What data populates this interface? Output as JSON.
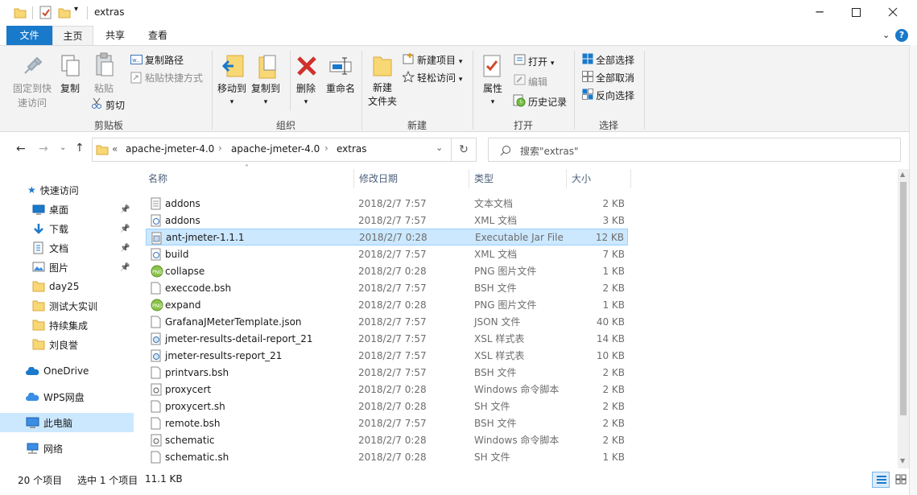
{
  "window": {
    "title": "extras"
  },
  "tabs": {
    "file": "文件",
    "home": "主页",
    "share": "共享",
    "view": "查看"
  },
  "ribbon": {
    "pin": "固定到快",
    "pin2": "速访问",
    "copy": "复制",
    "paste": "粘贴",
    "copy_path": "复制路径",
    "paste_shortcut": "粘贴快捷方式",
    "cut": "剪切",
    "clipboard": "剪贴板",
    "move_to": "移动到",
    "copy_to": "复制到",
    "delete": "删除",
    "rename": "重命名",
    "organize": "组织",
    "new_folder": "新建",
    "new_folder2": "文件夹",
    "new_item": "新建项目",
    "easy_access": "轻松访问",
    "new_group": "新建",
    "properties": "属性",
    "open": "打开",
    "edit": "编辑",
    "history": "历史记录",
    "open_group": "打开",
    "select_all": "全部选择",
    "select_none": "全部取消",
    "invert": "反向选择",
    "select_group": "选择"
  },
  "address": {
    "prefix": "«",
    "crumbs": [
      "apache-jmeter-4.0",
      "apache-jmeter-4.0",
      "extras"
    ],
    "search_placeholder": "搜索\"extras\""
  },
  "nav": {
    "quick_access": "快速访问",
    "items": [
      {
        "label": "桌面",
        "icon": "desktop-icon",
        "pinned": true
      },
      {
        "label": "下载",
        "icon": "download-icon",
        "pinned": true
      },
      {
        "label": "文档",
        "icon": "document-icon",
        "pinned": true
      },
      {
        "label": "图片",
        "icon": "picture-icon",
        "pinned": true
      },
      {
        "label": "day25",
        "icon": "folder-icon"
      },
      {
        "label": "测试大实训",
        "icon": "folder-icon"
      },
      {
        "label": "持续集成",
        "icon": "folder-icon"
      },
      {
        "label": "刘良誉",
        "icon": "folder-icon"
      }
    ],
    "onedrive": "OneDrive",
    "wps": "WPS网盘",
    "this_pc": "此电脑",
    "network": "网络"
  },
  "columns": {
    "name": "名称",
    "date": "修改日期",
    "type": "类型",
    "size": "大小"
  },
  "files": [
    {
      "name": "addons",
      "date": "2018/2/7 7:57",
      "type": "文本文档",
      "size": "2 KB",
      "icon": "text-file-icon"
    },
    {
      "name": "addons",
      "date": "2018/2/7 7:57",
      "type": "XML 文档",
      "size": "3 KB",
      "icon": "xml-file-icon"
    },
    {
      "name": "ant-jmeter-1.1.1",
      "date": "2018/2/7 0:28",
      "type": "Executable Jar File",
      "size": "12 KB",
      "icon": "jar-file-icon",
      "selected": true
    },
    {
      "name": "build",
      "date": "2018/2/7 7:57",
      "type": "XML 文档",
      "size": "7 KB",
      "icon": "xml-file-icon"
    },
    {
      "name": "collapse",
      "date": "2018/2/7 0:28",
      "type": "PNG 图片文件",
      "size": "1 KB",
      "icon": "png-file-icon"
    },
    {
      "name": "execcode.bsh",
      "date": "2018/2/7 7:57",
      "type": "BSH 文件",
      "size": "2 KB",
      "icon": "blank-file-icon"
    },
    {
      "name": "expand",
      "date": "2018/2/7 0:28",
      "type": "PNG 图片文件",
      "size": "1 KB",
      "icon": "png-file-icon"
    },
    {
      "name": "GrafanaJMeterTemplate.json",
      "date": "2018/2/7 7:57",
      "type": "JSON 文件",
      "size": "40 KB",
      "icon": "blank-file-icon"
    },
    {
      "name": "jmeter-results-detail-report_21",
      "date": "2018/2/7 7:57",
      "type": "XSL 样式表",
      "size": "14 KB",
      "icon": "xsl-file-icon"
    },
    {
      "name": "jmeter-results-report_21",
      "date": "2018/2/7 7:57",
      "type": "XSL 样式表",
      "size": "10 KB",
      "icon": "xsl-file-icon"
    },
    {
      "name": "printvars.bsh",
      "date": "2018/2/7 7:57",
      "type": "BSH 文件",
      "size": "2 KB",
      "icon": "blank-file-icon"
    },
    {
      "name": "proxycert",
      "date": "2018/2/7 0:28",
      "type": "Windows 命令脚本",
      "size": "2 KB",
      "icon": "cmd-file-icon"
    },
    {
      "name": "proxycert.sh",
      "date": "2018/2/7 0:28",
      "type": "SH 文件",
      "size": "2 KB",
      "icon": "blank-file-icon"
    },
    {
      "name": "remote.bsh",
      "date": "2018/2/7 7:57",
      "type": "BSH 文件",
      "size": "2 KB",
      "icon": "blank-file-icon"
    },
    {
      "name": "schematic",
      "date": "2018/2/7 0:28",
      "type": "Windows 命令脚本",
      "size": "2 KB",
      "icon": "cmd-file-icon"
    },
    {
      "name": "schematic.sh",
      "date": "2018/2/7 0:28",
      "type": "SH 文件",
      "size": "1 KB",
      "icon": "blank-file-icon"
    }
  ],
  "status": {
    "count": "20 个项目",
    "selected": "选中 1 个项目",
    "size": "11.1 KB"
  },
  "colors": {
    "accent": "#1979ca",
    "selection": "#cce8ff"
  }
}
